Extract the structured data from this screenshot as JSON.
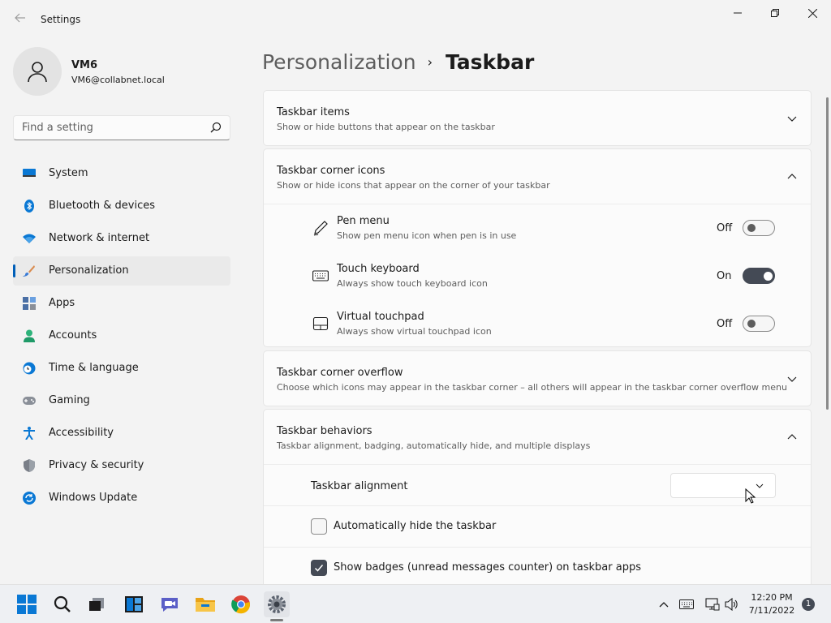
{
  "window": {
    "app_title": "Settings",
    "controls": {
      "minimize": "minimize",
      "maximize": "maximize",
      "close": "close"
    }
  },
  "user": {
    "name": "VM6",
    "email": "VM6@collabnet.local"
  },
  "search": {
    "placeholder": "Find a setting"
  },
  "nav": {
    "items": [
      {
        "label": "System",
        "icon": "monitor-icon"
      },
      {
        "label": "Bluetooth & devices",
        "icon": "bluetooth-icon"
      },
      {
        "label": "Network & internet",
        "icon": "wifi-icon"
      },
      {
        "label": "Personalization",
        "icon": "brush-icon",
        "active": true
      },
      {
        "label": "Apps",
        "icon": "apps-icon"
      },
      {
        "label": "Accounts",
        "icon": "person-icon"
      },
      {
        "label": "Time & language",
        "icon": "clock-globe-icon"
      },
      {
        "label": "Gaming",
        "icon": "gamepad-icon"
      },
      {
        "label": "Accessibility",
        "icon": "accessibility-icon"
      },
      {
        "label": "Privacy & security",
        "icon": "shield-icon"
      },
      {
        "label": "Windows Update",
        "icon": "update-icon"
      }
    ]
  },
  "breadcrumb": {
    "parent": "Personalization",
    "separator": "›",
    "current": "Taskbar"
  },
  "sections": {
    "taskbar_items": {
      "title": "Taskbar items",
      "description": "Show or hide buttons that appear on the taskbar",
      "expanded": false
    },
    "corner_icons": {
      "title": "Taskbar corner icons",
      "description": "Show or hide icons that appear on the corner of your taskbar",
      "expanded": true,
      "rows": [
        {
          "title": "Pen menu",
          "description": "Show pen menu icon when pen is in use",
          "state": "Off",
          "on": false,
          "icon": "pen-icon"
        },
        {
          "title": "Touch keyboard",
          "description": "Always show touch keyboard icon",
          "state": "On",
          "on": true,
          "icon": "keyboard-icon"
        },
        {
          "title": "Virtual touchpad",
          "description": "Always show virtual touchpad icon",
          "state": "Off",
          "on": false,
          "icon": "touchpad-icon"
        }
      ]
    },
    "corner_overflow": {
      "title": "Taskbar corner overflow",
      "description": "Choose which icons may appear in the taskbar corner – all others will appear in the taskbar corner overflow menu",
      "expanded": false
    },
    "behaviors": {
      "title": "Taskbar behaviors",
      "description": "Taskbar alignment, badging, automatically hide, and multiple displays",
      "expanded": true,
      "alignment_label": "Taskbar alignment",
      "alignment_value": "",
      "auto_hide_label": "Automatically hide the taskbar",
      "auto_hide_checked": false,
      "badges_label": "Show badges (unread messages counter) on taskbar apps",
      "badges_checked": true
    }
  },
  "taskbar": {
    "apps": [
      {
        "name": "start-icon"
      },
      {
        "name": "search-icon"
      },
      {
        "name": "task-view-icon"
      },
      {
        "name": "widgets-icon"
      },
      {
        "name": "teams-chat-icon"
      },
      {
        "name": "file-explorer-icon"
      },
      {
        "name": "chrome-icon"
      },
      {
        "name": "settings-icon",
        "active": true
      }
    ],
    "tray": {
      "time": "12:20 PM",
      "date": "7/11/2022",
      "notification_count": "1"
    }
  },
  "colors": {
    "accent": "#005fb8",
    "toggle_on": "#444a55",
    "background": "#f3f3f3",
    "card": "#fbfbfb"
  }
}
